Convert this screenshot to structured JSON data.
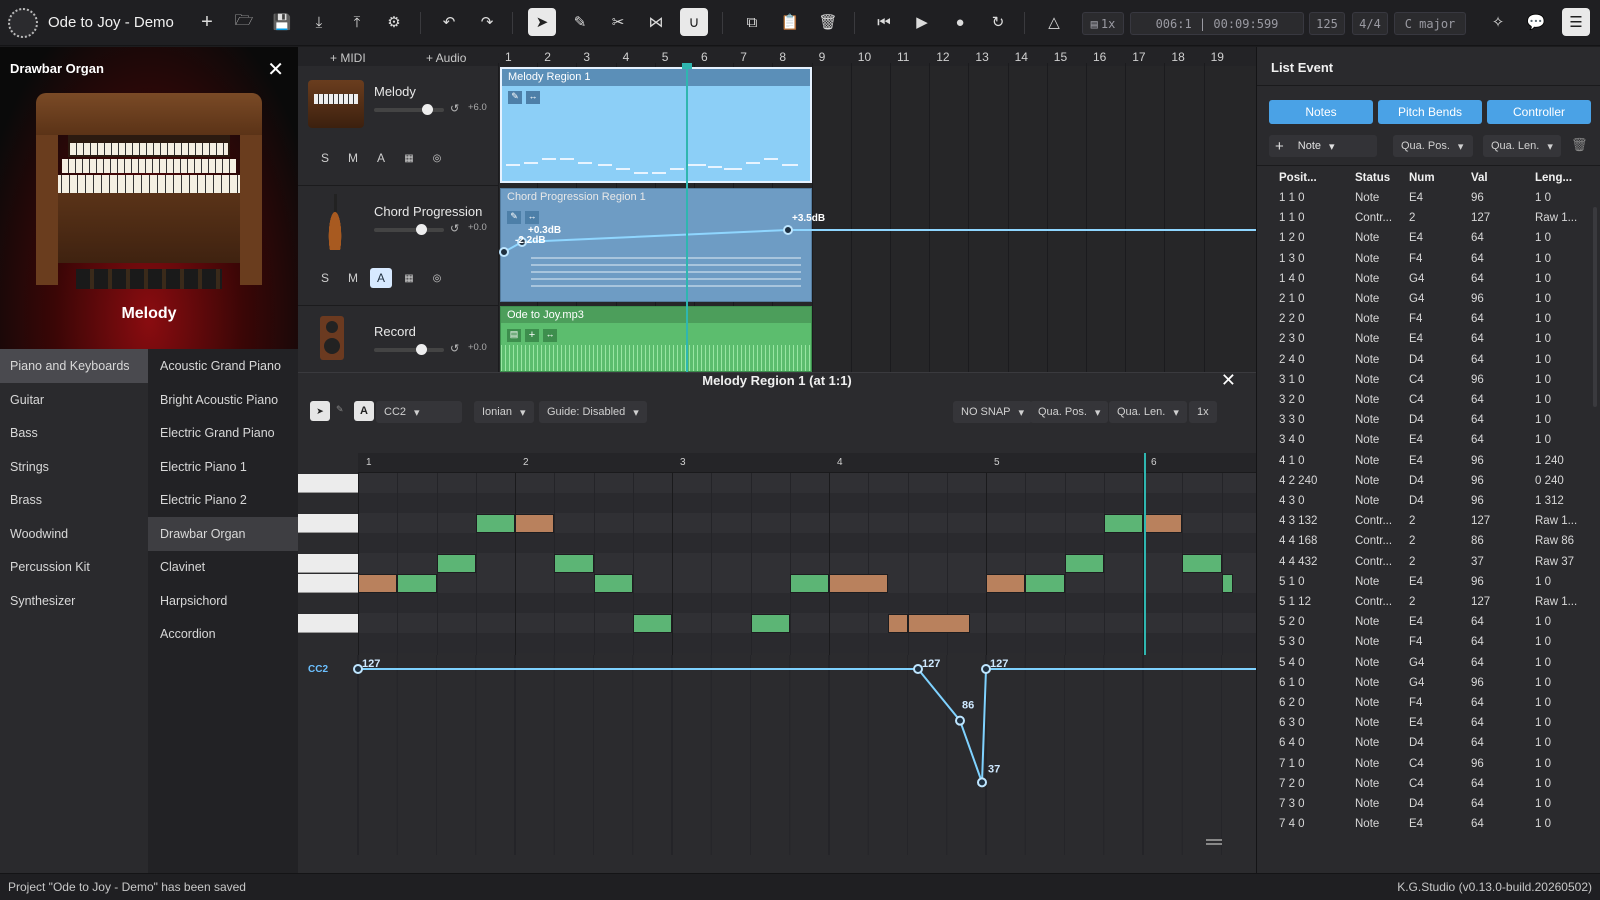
{
  "app": {
    "title": "Ode to Joy - Demo"
  },
  "toolbar": {
    "zoom": "1x",
    "position": "006:1 | 00:09:599",
    "tempo": "125",
    "time_signature": "4/4",
    "key": "C major"
  },
  "left_panel": {
    "title": "Drawbar Organ",
    "caption": "Melody",
    "categories": [
      {
        "label": "Piano and Keyboards",
        "selected": true
      },
      {
        "label": "Guitar"
      },
      {
        "label": "Bass"
      },
      {
        "label": "Strings"
      },
      {
        "label": "Brass"
      },
      {
        "label": "Woodwind"
      },
      {
        "label": "Percussion Kit"
      },
      {
        "label": "Synthesizer"
      }
    ],
    "instruments": [
      {
        "label": "Acoustic Grand Piano"
      },
      {
        "label": "Bright Acoustic Piano"
      },
      {
        "label": "Electric Grand Piano"
      },
      {
        "label": "Electric Piano 1"
      },
      {
        "label": "Electric Piano 2"
      },
      {
        "label": "Drawbar Organ",
        "selected": true
      },
      {
        "label": "Clavinet"
      },
      {
        "label": "Harpsichord"
      },
      {
        "label": "Accordion"
      }
    ]
  },
  "arranger": {
    "add_midi": "+ MIDI",
    "add_audio": "+ Audio",
    "ruler": [
      "1",
      "2",
      "3",
      "4",
      "5",
      "6",
      "7",
      "8",
      "9",
      "10",
      "11",
      "12",
      "13",
      "14",
      "15",
      "16",
      "17",
      "18",
      "19"
    ],
    "tracks": [
      {
        "name": "Melody",
        "gain": "+6.0",
        "region": "Melody Region 1"
      },
      {
        "name": "Chord Progression",
        "gain": "+0.0",
        "region": "Chord Progression Region 1",
        "automation_labels": [
          "+0.3dB",
          "-2.2dB",
          "+3.5dB"
        ]
      },
      {
        "name": "Record",
        "gain": "+0.0",
        "region": "Ode to Joy.mp3"
      }
    ],
    "smb": [
      "S",
      "M",
      "A"
    ]
  },
  "editor": {
    "title": "Melody Region 1 (at 1:1)",
    "controller": "CC2",
    "scale": "Ionian",
    "guide": "Guide: Disabled",
    "snap": "NO SNAP",
    "qua_pos": "Qua. Pos.",
    "qua_len": "Qua. Len.",
    "zoom": "1x",
    "a_label": "A",
    "bars": [
      "1",
      "2",
      "3",
      "4",
      "5",
      "6"
    ],
    "cc_lane_label": "CC2",
    "cc_values": [
      "127",
      "127",
      "86",
      "37",
      "127"
    ]
  },
  "list_event": {
    "title": "List Event",
    "tabs": [
      "Notes",
      "Pitch Bends",
      "Controller"
    ],
    "type_select": "Note",
    "qua_pos": "Qua. Pos.",
    "qua_len": "Qua. Len.",
    "columns": [
      "Posit...",
      "Status",
      "Num",
      "Val",
      "Leng..."
    ],
    "rows": [
      [
        "1 1 0",
        "Note",
        "E4",
        "96",
        "1 0"
      ],
      [
        "1 1 0",
        "Contr...",
        "2",
        "127",
        "Raw 1..."
      ],
      [
        "1 2 0",
        "Note",
        "E4",
        "64",
        "1 0"
      ],
      [
        "1 3 0",
        "Note",
        "F4",
        "64",
        "1 0"
      ],
      [
        "1 4 0",
        "Note",
        "G4",
        "64",
        "1 0"
      ],
      [
        "2 1 0",
        "Note",
        "G4",
        "96",
        "1 0"
      ],
      [
        "2 2 0",
        "Note",
        "F4",
        "64",
        "1 0"
      ],
      [
        "2 3 0",
        "Note",
        "E4",
        "64",
        "1 0"
      ],
      [
        "2 4 0",
        "Note",
        "D4",
        "64",
        "1 0"
      ],
      [
        "3 1 0",
        "Note",
        "C4",
        "96",
        "1 0"
      ],
      [
        "3 2 0",
        "Note",
        "C4",
        "64",
        "1 0"
      ],
      [
        "3 3 0",
        "Note",
        "D4",
        "64",
        "1 0"
      ],
      [
        "3 4 0",
        "Note",
        "E4",
        "64",
        "1 0"
      ],
      [
        "4 1 0",
        "Note",
        "E4",
        "96",
        "1 240"
      ],
      [
        "4 2 240",
        "Note",
        "D4",
        "96",
        "0 240"
      ],
      [
        "4 3 0",
        "Note",
        "D4",
        "96",
        "1 312"
      ],
      [
        "4 3 132",
        "Contr...",
        "2",
        "127",
        "Raw 1..."
      ],
      [
        "4 4 168",
        "Contr...",
        "2",
        "86",
        "Raw 86"
      ],
      [
        "4 4 432",
        "Contr...",
        "2",
        "37",
        "Raw 37"
      ],
      [
        "5 1 0",
        "Note",
        "E4",
        "96",
        "1 0"
      ],
      [
        "5 1 12",
        "Contr...",
        "2",
        "127",
        "Raw 1..."
      ],
      [
        "5 2 0",
        "Note",
        "E4",
        "64",
        "1 0"
      ],
      [
        "5 3 0",
        "Note",
        "F4",
        "64",
        "1 0"
      ],
      [
        "5 4 0",
        "Note",
        "G4",
        "64",
        "1 0"
      ],
      [
        "6 1 0",
        "Note",
        "G4",
        "96",
        "1 0"
      ],
      [
        "6 2 0",
        "Note",
        "F4",
        "64",
        "1 0"
      ],
      [
        "6 3 0",
        "Note",
        "E4",
        "64",
        "1 0"
      ],
      [
        "6 4 0",
        "Note",
        "D4",
        "64",
        "1 0"
      ],
      [
        "7 1 0",
        "Note",
        "C4",
        "96",
        "1 0"
      ],
      [
        "7 2 0",
        "Note",
        "C4",
        "64",
        "1 0"
      ],
      [
        "7 3 0",
        "Note",
        "D4",
        "64",
        "1 0"
      ],
      [
        "7 4 0",
        "Note",
        "E4",
        "64",
        "1 0"
      ]
    ]
  },
  "status": {
    "message": "Project \"Ode to Joy - Demo\" has been saved",
    "version": "K.G.Studio (v0.13.0-build.20260502)"
  },
  "colors": {
    "accent": "#4aa2e6",
    "playhead": "#2fb6b0",
    "note_green": "#5cb575",
    "note_brown": "#b9815d",
    "midi_region": "#8ccff7",
    "audio_region": "#5cbd6e"
  }
}
